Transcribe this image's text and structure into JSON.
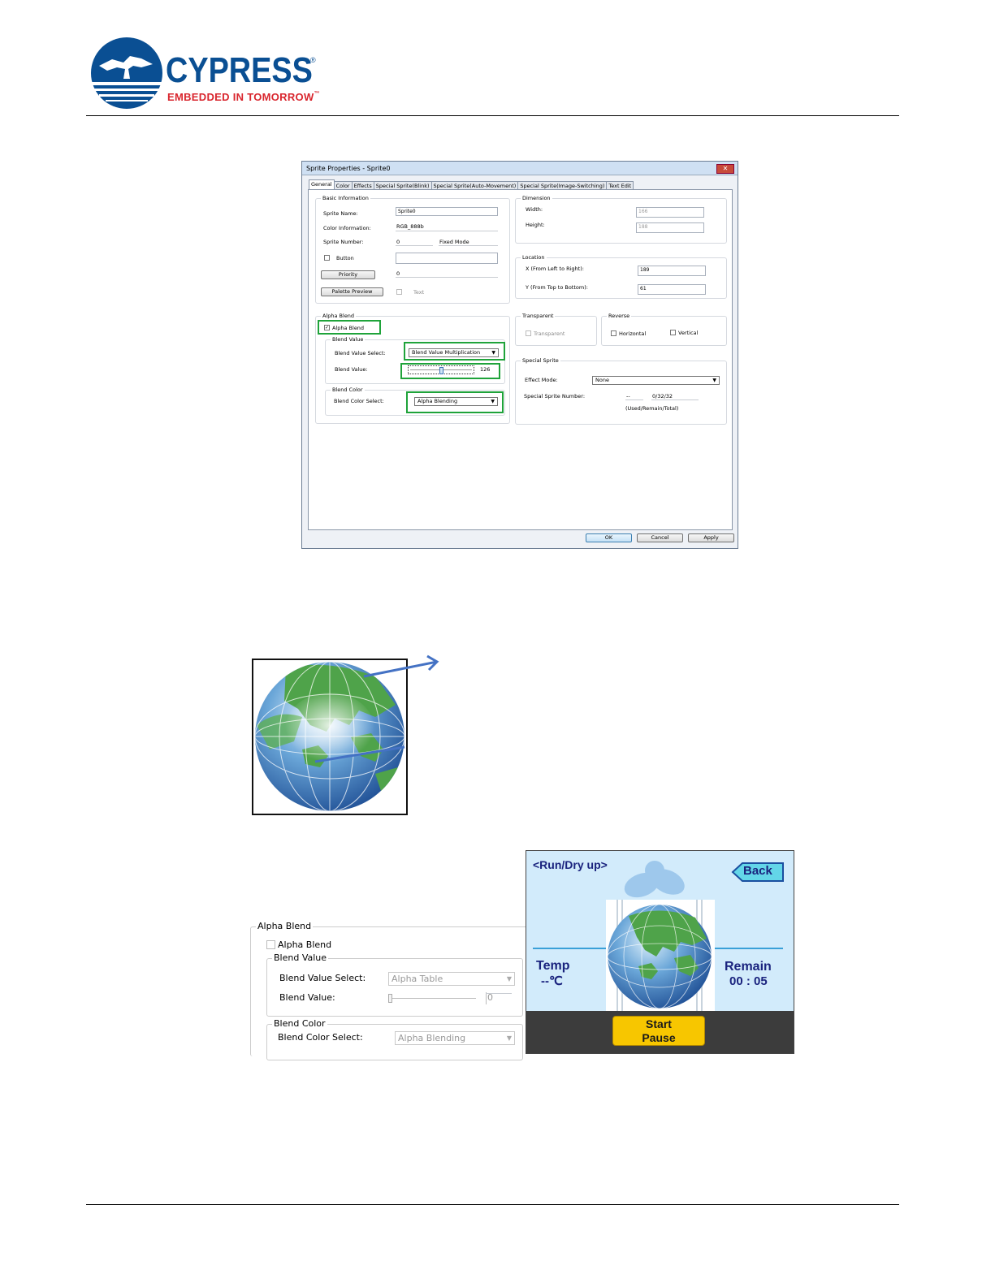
{
  "logo": {
    "brand": "CYPRESS",
    "tagline": "EMBEDDED IN TOMORROW",
    "tm": "™",
    "registered": "®"
  },
  "dialog": {
    "title": "Sprite Properties - Sprite0",
    "close_icon": "close-icon",
    "tabs": [
      "General",
      "Color",
      "Effects",
      "Special Sprite(Blink)",
      "Special Sprite(Auto-Movement)",
      "Special Sprite(Image-Switching)",
      "Text Edit"
    ],
    "basic_info": {
      "group": "Basic Information",
      "sprite_name_label": "Sprite Name:",
      "sprite_name_value": "Sprite0",
      "color_info_label": "Color Information:",
      "color_info_value": "RGB_888b",
      "sprite_number_label": "Sprite Number:",
      "sprite_number_value": "0",
      "fixed_mode": "Fixed Mode",
      "button_label": "Button",
      "priority_button": "Priority",
      "priority_value": "0",
      "palette_preview_button": "Palette Preview",
      "text_label": "Text"
    },
    "dimension": {
      "group": "Dimension",
      "width_label": "Width:",
      "width_value": "166",
      "height_label": "Height:",
      "height_value": "188"
    },
    "location": {
      "group": "Location",
      "x_label": "X (From Left to Right):",
      "x_value": "189",
      "y_label": "Y (From Top to Bottom):",
      "y_value": "61"
    },
    "alpha_blend": {
      "group": "Alpha Blend",
      "checkbox_label": "Alpha Blend",
      "blend_value_group": "Blend Value",
      "blend_value_select_label": "Blend Value Select:",
      "blend_value_select_value": "Blend Value Multiplication",
      "blend_value_label": "Blend Value:",
      "blend_value_number": "126",
      "blend_value_fraction": 0.49,
      "blend_color_group": "Blend Color",
      "blend_color_select_label": "Blend Color Select:",
      "blend_color_select_value": "Alpha Blending"
    },
    "transparent": {
      "group": "Transparent",
      "checkbox_label": "Transparent"
    },
    "reverse": {
      "group": "Reverse",
      "horizontal_label": "Horizontal",
      "vertical_label": "Vertical"
    },
    "special_sprite": {
      "group": "Special Sprite",
      "effect_mode_label": "Effect Mode:",
      "effect_mode_value": "None",
      "number_label": "Special Sprite Number:",
      "number_value": "--",
      "count_value": "0/32/32",
      "note": "(Used/Remain/Total)"
    },
    "footer": {
      "ok": "OK",
      "cancel": "Cancel",
      "apply": "Apply"
    }
  },
  "alpha_panel": {
    "group": "Alpha Blend",
    "checkbox_label": "Alpha Blend",
    "blend_value_group": "Blend Value",
    "blend_value_select_label": "Blend Value Select:",
    "blend_value_select_value": "Alpha Table",
    "blend_value_label": "Blend Value:",
    "blend_value_number": "0",
    "blend_color_group": "Blend Color",
    "blend_color_select_label": "Blend Color Select:",
    "blend_color_select_value": "Alpha Blending"
  },
  "device_screen": {
    "header": "<Run/Dry up>",
    "back_button": "Back",
    "temp_label": "Temp",
    "temp_value": "--℃",
    "remain_label": "Remain",
    "remain_value": "00 : 05",
    "start_label": "Start",
    "pause_label": "Pause"
  },
  "colors": {
    "brand_blue": "#0a4f93",
    "brand_red": "#d9262e",
    "highlight_green": "#1fa33a",
    "arrow_blue": "#4472c4",
    "screen_bg": "#d2ebfb",
    "start_button": "#f7c600"
  }
}
